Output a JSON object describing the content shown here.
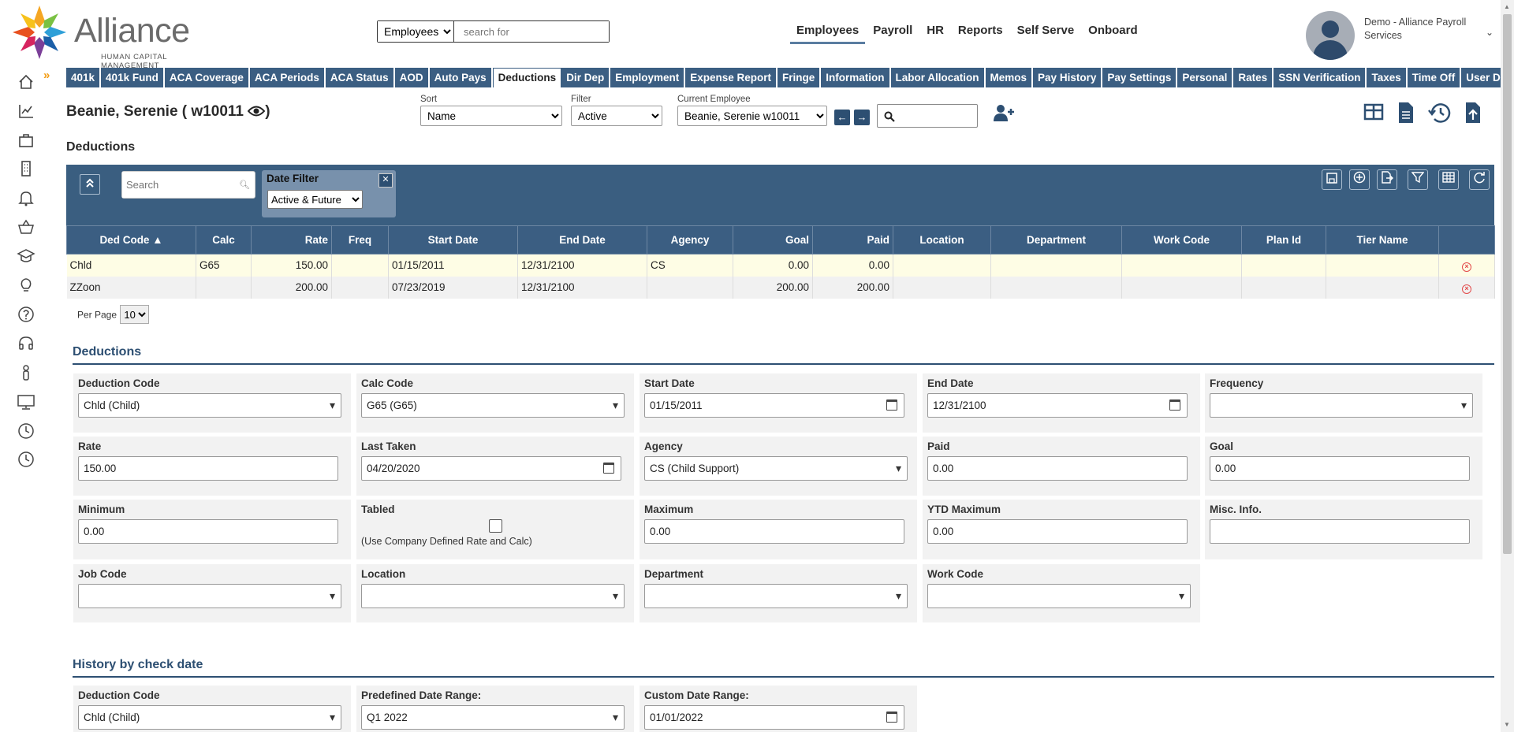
{
  "header": {
    "logo_name": "Alliance",
    "logo_sub": "HUMAN CAPITAL MANAGEMENT",
    "search_scope": "Employees",
    "search_placeholder": "search for",
    "nav": [
      "Employees",
      "Payroll",
      "HR",
      "Reports",
      "Self Serve",
      "Onboard"
    ],
    "active_nav": "Employees",
    "user_name": "Demo - Alliance Payroll Services"
  },
  "rail_icons": [
    "home-icon",
    "chart-icon",
    "briefcase-icon",
    "building-icon",
    "bell-icon",
    "basket-icon",
    "graduation-cap-icon",
    "lightbulb-icon",
    "help-icon",
    "headset-icon",
    "person-icon",
    "desktop-icon",
    "clock-icon",
    "clock-icon"
  ],
  "tabs": [
    "401k",
    "401k Fund",
    "ACA Coverage",
    "ACA Periods",
    "ACA Status",
    "AOD",
    "Auto Pays",
    "Deductions",
    "Dir Dep",
    "Employment",
    "Expense Report",
    "Fringe",
    "Information",
    "Labor Allocation",
    "Memos",
    "Pay History",
    "Pay Settings",
    "Personal",
    "Rates",
    "SSN Verification",
    "Taxes",
    "Time Off",
    "User Defined"
  ],
  "active_tab": "Deductions",
  "employee": {
    "name": "Beanie, Serenie ( w10011",
    "sort_label": "Sort",
    "sort_value": "Name",
    "filter_label": "Filter",
    "filter_value": "Active",
    "current_label": "Current Employee",
    "current_value": "Beanie, Serenie w10011"
  },
  "page_title": "Deductions",
  "grid": {
    "search_placeholder": "Search",
    "date_filter_title": "Date Filter",
    "date_filter_value": "Active & Future",
    "columns": [
      "Ded Code ▲",
      "Calc",
      "Rate",
      "Freq",
      "Start Date",
      "End Date",
      "Agency",
      "Goal",
      "Paid",
      "Location",
      "Department",
      "Work Code",
      "Plan Id",
      "Tier Name",
      ""
    ],
    "rows": [
      [
        "Chld",
        "G65",
        "150.00",
        "",
        "01/15/2011",
        "12/31/2100",
        "CS",
        "0.00",
        "0.00",
        "",
        "",
        "",
        "",
        ""
      ],
      [
        "ZZoon",
        "",
        "200.00",
        "",
        "07/23/2019",
        "12/31/2100",
        "",
        "200.00",
        "200.00",
        "",
        "",
        "",
        "",
        ""
      ]
    ],
    "per_page_label": "Per Page",
    "per_page_value": "10"
  },
  "deductions_form": {
    "heading": "Deductions",
    "fields": {
      "deduction_code": {
        "label": "Deduction Code",
        "value": "Chld (Child)"
      },
      "calc_code": {
        "label": "Calc Code",
        "value": "G65 (G65)"
      },
      "start_date": {
        "label": "Start Date",
        "value": "01/15/2011"
      },
      "end_date": {
        "label": "End Date",
        "value": "12/31/2100"
      },
      "frequency": {
        "label": "Frequency",
        "value": ""
      },
      "rate": {
        "label": "Rate",
        "value": "150.00"
      },
      "last_taken": {
        "label": "Last Taken",
        "value": "04/20/2020"
      },
      "agency": {
        "label": "Agency",
        "value": "CS (Child Support)"
      },
      "paid": {
        "label": "Paid",
        "value": "0.00"
      },
      "goal": {
        "label": "Goal",
        "value": "0.00"
      },
      "minimum": {
        "label": "Minimum",
        "value": "0.00"
      },
      "tabled": {
        "label": "Tabled",
        "note": "(Use Company Defined Rate and Calc)"
      },
      "maximum": {
        "label": "Maximum",
        "value": "0.00"
      },
      "ytd_maximum": {
        "label": "YTD Maximum",
        "value": "0.00"
      },
      "misc_info": {
        "label": "Misc. Info.",
        "value": ""
      },
      "job_code": {
        "label": "Job Code",
        "value": ""
      },
      "location": {
        "label": "Location",
        "value": ""
      },
      "department": {
        "label": "Department",
        "value": ""
      },
      "work_code": {
        "label": "Work Code",
        "value": ""
      }
    }
  },
  "history": {
    "heading": "History by check date",
    "deduction_code": {
      "label": "Deduction Code",
      "value": "Chld (Child)"
    },
    "predefined_range": {
      "label": "Predefined Date Range:",
      "value": "Q1 2022"
    },
    "custom_range": {
      "label": "Custom Date Range:",
      "value": "01/01/2022"
    }
  }
}
